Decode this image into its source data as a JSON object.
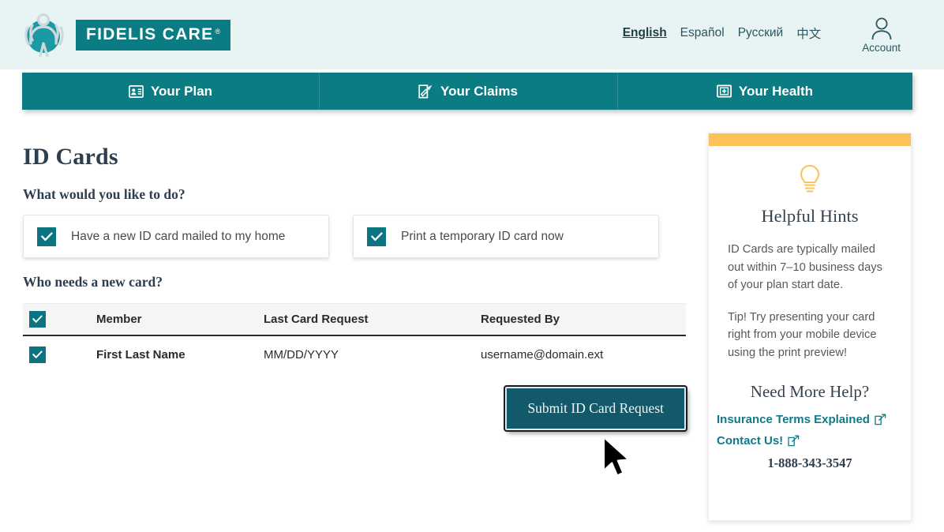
{
  "header": {
    "logo_text": "FIDELIS CARE",
    "logo_reg": "®",
    "logo_icon": "fidelis-figure-logo",
    "languages": [
      {
        "label": "English",
        "active": true
      },
      {
        "label": "Español",
        "active": false
      },
      {
        "label": "Русский",
        "active": false
      },
      {
        "label": "中文",
        "active": false
      }
    ],
    "account_label": "Account",
    "account_icon": "user-account-icon"
  },
  "nav": {
    "tabs": [
      {
        "label": "Your Plan",
        "icon": "id-card-icon"
      },
      {
        "label": "Your Claims",
        "icon": "document-pen-icon"
      },
      {
        "label": "Your Health",
        "icon": "medical-kit-icon"
      }
    ]
  },
  "main": {
    "page_title": "ID Cards",
    "question_1": "What would you like to do?",
    "options": [
      {
        "label": "Have a new ID card mailed to my home",
        "checked": true
      },
      {
        "label": "Print a temporary ID card now",
        "checked": true
      }
    ],
    "question_2": "Who needs a new card?",
    "table": {
      "headers": [
        "Member",
        "Last Card Request",
        "Requested By"
      ],
      "select_all_checked": true,
      "rows": [
        {
          "checked": true,
          "member": "First Last Name",
          "last_card_request": "MM/DD/YYYY",
          "requested_by": "username@domain.ext"
        }
      ]
    },
    "submit_label": "Submit ID Card Request"
  },
  "sidebar": {
    "hint_icon": "lightbulb-icon",
    "title": "Helpful Hints",
    "paragraph_1": "ID Cards are typically mailed out within 7–10 business days of your plan start date.",
    "paragraph_2": "Tip! Try presenting your card right from your mobile device using the print preview!",
    "help_title": "Need More Help?",
    "links": [
      {
        "label": "Insurance Terms Explained",
        "icon": "external-link-icon"
      },
      {
        "label": "Contact Us!",
        "icon": "external-link-icon"
      }
    ],
    "phone": "1-888-343-3547"
  },
  "colors": {
    "teal": "#0b7c84",
    "teal_dark": "#12596b",
    "header_bg": "#e8f4f4",
    "amber": "#fcc256",
    "link_teal": "#0f7b8a"
  },
  "cursor": {
    "icon": "mouse-pointer-icon"
  }
}
